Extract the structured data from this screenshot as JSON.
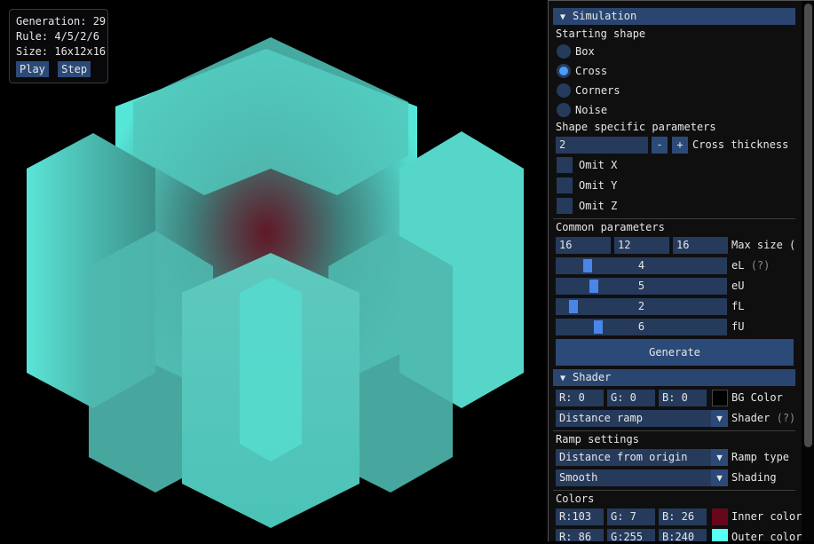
{
  "overlay": {
    "generation_label": "Generation: 29",
    "rule_label": "Rule: 4/5/2/6",
    "size_label": "Size: 16x12x16",
    "play_label": "Play",
    "step_label": "Step"
  },
  "simulation": {
    "header": "Simulation",
    "starting_shape_label": "Starting shape",
    "shapes": [
      "Box",
      "Cross",
      "Corners",
      "Noise"
    ],
    "selected_shape": "Cross",
    "shape_params_label": "Shape specific parameters",
    "cross_thickness_value": "2",
    "minus_label": "-",
    "plus_label": "+",
    "cross_thickness_label": "Cross thickness",
    "omit_x": "Omit X",
    "omit_y": "Omit Y",
    "omit_z": "Omit Z",
    "common_params_label": "Common parameters",
    "max_size_x": "16",
    "max_size_y": "12",
    "max_size_z": "16",
    "max_size_label": "Max size (",
    "sliders": {
      "eL": {
        "label": "eL",
        "value": "4",
        "fraction": 0.16
      },
      "eU": {
        "label": "eU",
        "value": "5",
        "fraction": 0.2
      },
      "fL": {
        "label": "fL",
        "value": "2",
        "fraction": 0.07
      },
      "fU": {
        "label": "fU",
        "value": "6",
        "fraction": 0.23
      }
    },
    "help_mark": "(?)",
    "generate_label": "Generate"
  },
  "shader": {
    "header": "Shader",
    "bg_r": "R:  0",
    "bg_g": "G:  0",
    "bg_b": "B:  0",
    "bg_color_label": "BG Color",
    "bg_color": "#000000",
    "shader_value": "Distance ramp",
    "shader_label": "Shader",
    "ramp_settings_label": "Ramp settings",
    "ramp_type_value": "Distance from origin",
    "ramp_type_label": "Ramp type",
    "shading_value": "Smooth",
    "shading_label": "Shading",
    "colors_label": "Colors",
    "inner_r": "R:103",
    "inner_g": "G:  7",
    "inner_b": "B: 26",
    "inner_label": "Inner color",
    "inner_color": "#67071a",
    "outer_r": "R: 86",
    "outer_g": "G:255",
    "outer_b": "B:240",
    "outer_label": "Outer color",
    "outer_color": "#56fff0"
  },
  "colors": {
    "header_bg": "#2a4670",
    "button_bg": "#2c4a78",
    "frame_bg": "#263b5c",
    "accent": "#4a86e8",
    "voxel_outer": "#56fff0",
    "voxel_inner": "#67071a"
  }
}
